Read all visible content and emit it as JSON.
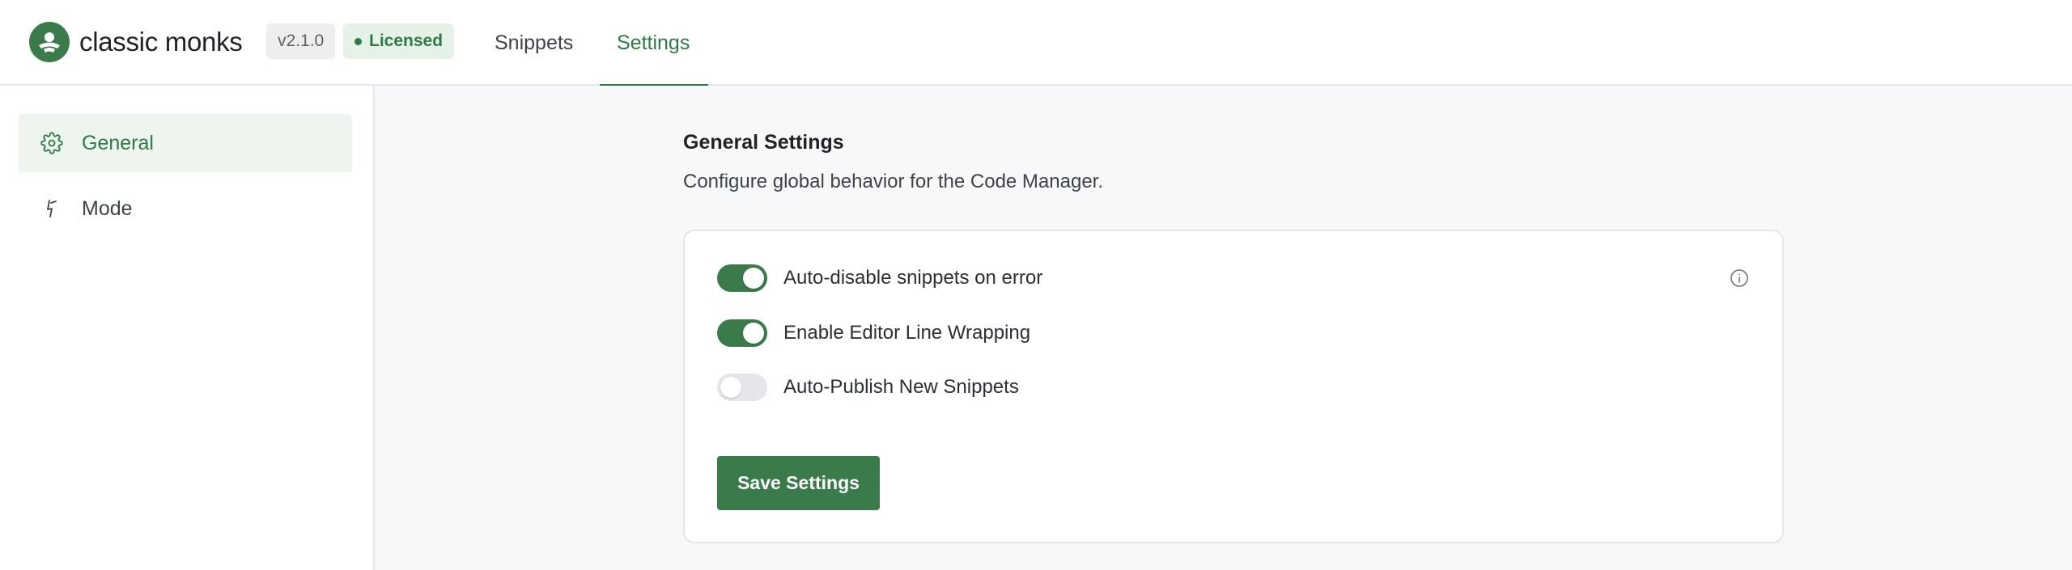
{
  "header": {
    "brand": "classic monks",
    "version": "v2.1.0",
    "license_status": "Licensed",
    "tabs": [
      {
        "label": "Snippets",
        "active": false
      },
      {
        "label": "Settings",
        "active": true
      }
    ]
  },
  "sidebar": {
    "items": [
      {
        "label": "General",
        "icon": "gear-icon",
        "active": true
      },
      {
        "label": "Mode",
        "icon": "lightning-icon",
        "active": false
      }
    ]
  },
  "main": {
    "title": "General Settings",
    "description": "Configure global behavior for the Code Manager.",
    "settings": [
      {
        "label": "Auto-disable snippets on error",
        "enabled": true,
        "info_icon": "info-icon"
      },
      {
        "label": "Enable Editor Line Wrapping",
        "enabled": true
      },
      {
        "label": "Auto-Publish New Snippets",
        "enabled": false
      }
    ],
    "save_label": "Save Settings"
  },
  "colors": {
    "accent": "#3a7a4b",
    "accent_light": "#edf5ee",
    "background": "#f7f8f9"
  }
}
